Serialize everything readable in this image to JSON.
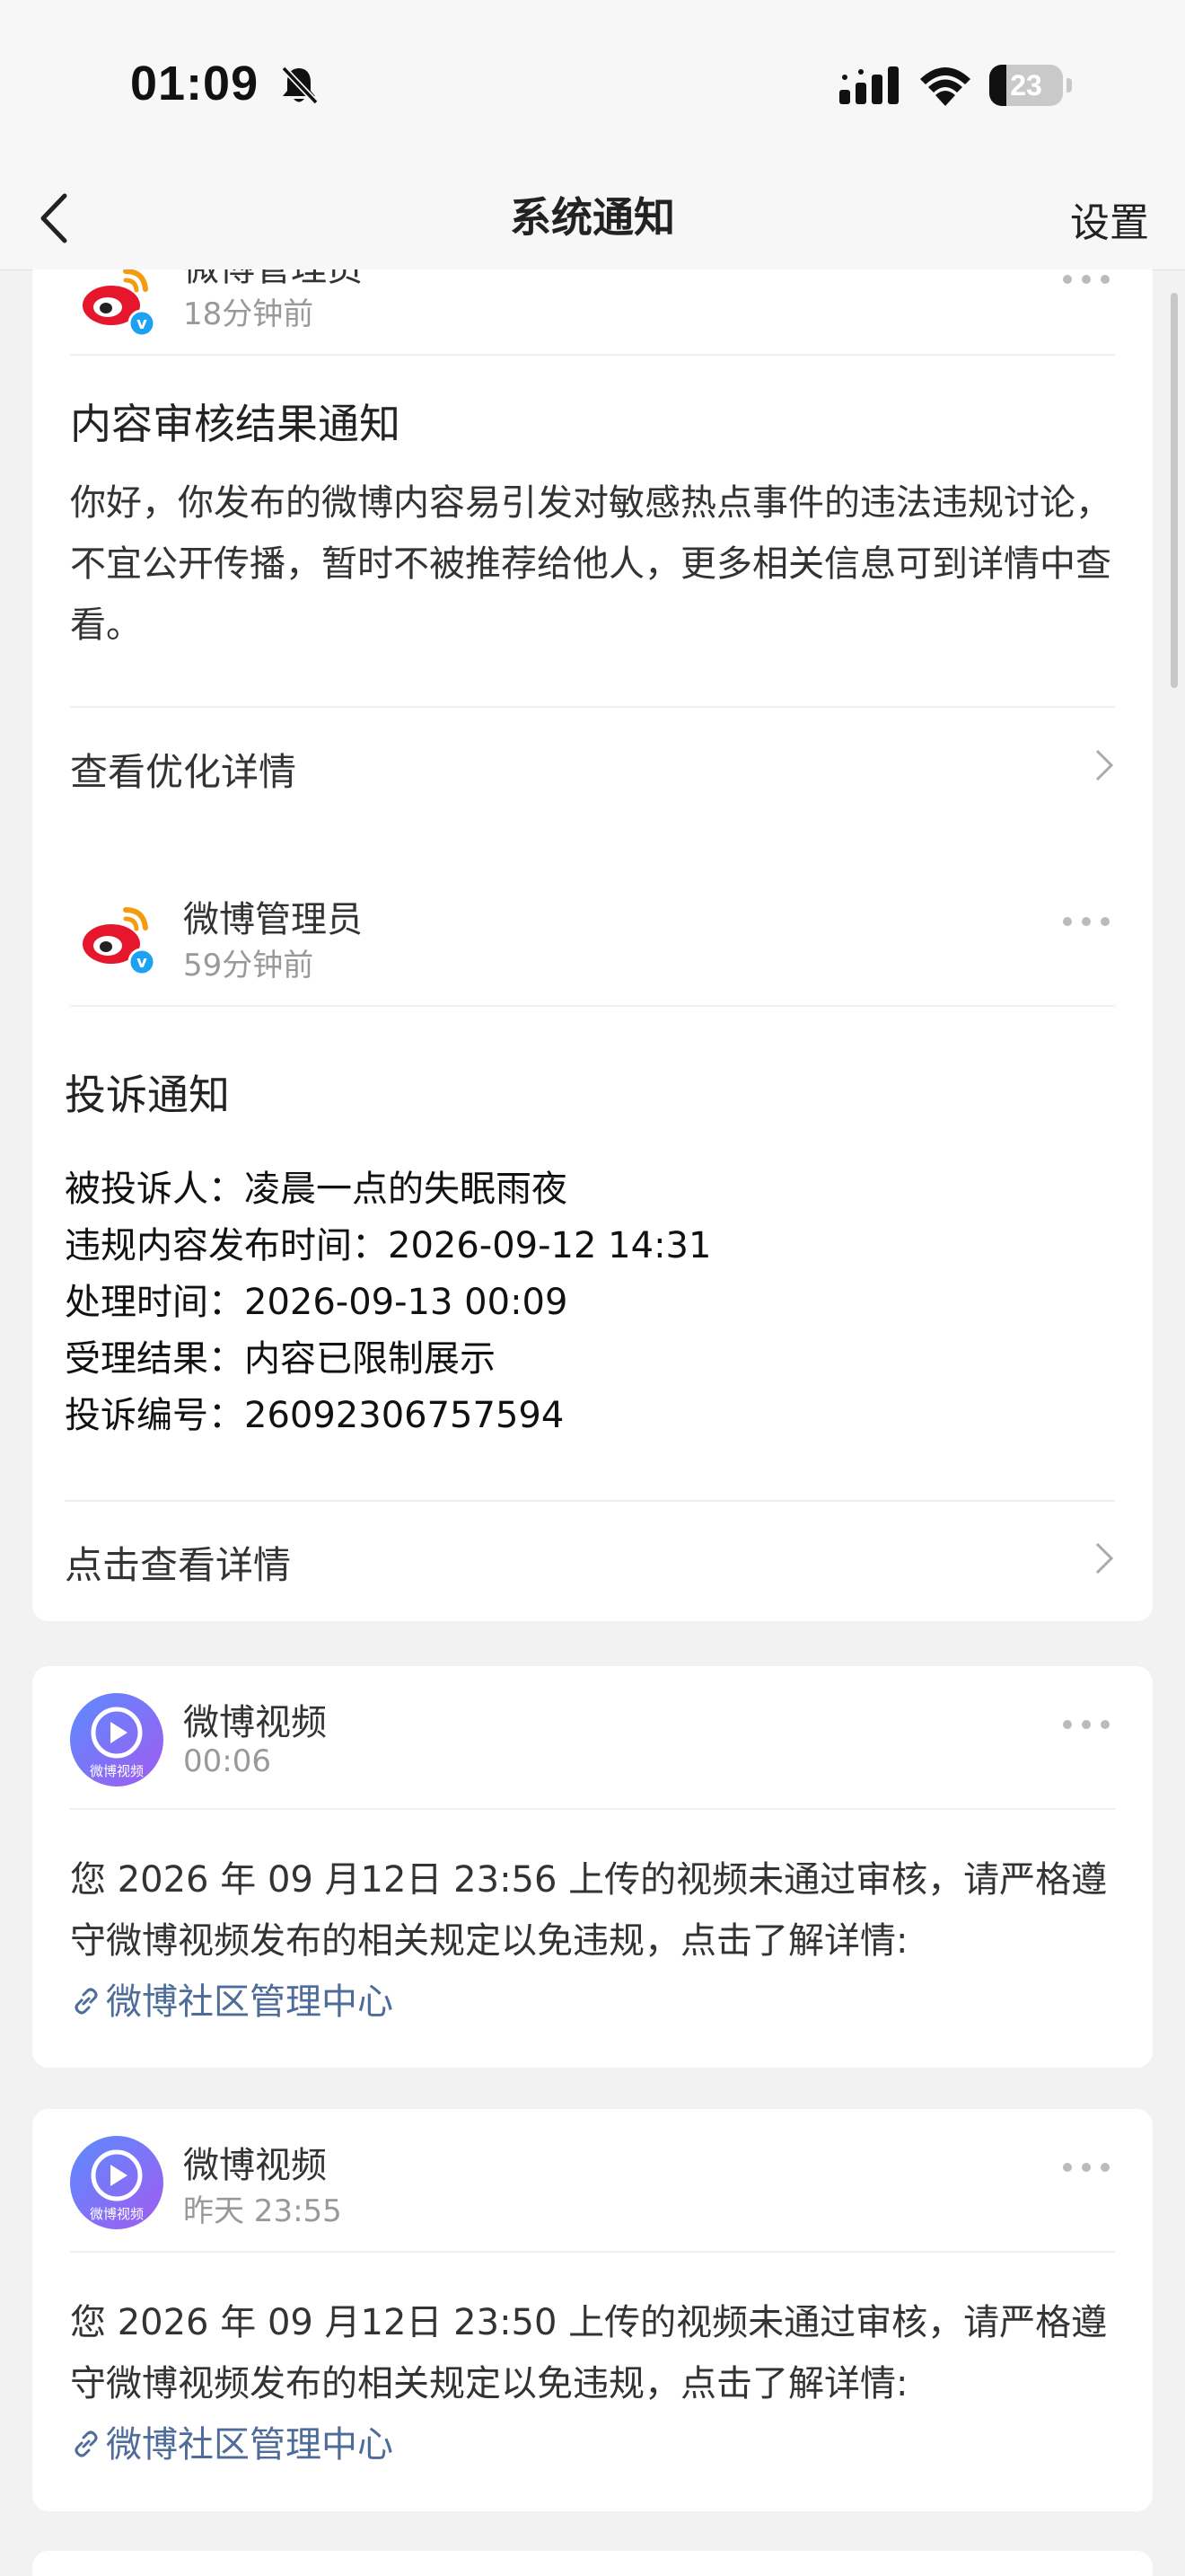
{
  "status": {
    "time": "01:09",
    "battery": "23",
    "battery_level": 0.23
  },
  "nav": {
    "title": "系统通知",
    "settings": "设置"
  },
  "colors": {
    "link": "#4d6c99",
    "weibo_red": "#e6162d",
    "weibo_orange": "#f39c12",
    "verified_blue": "#1da1f2",
    "video_purple": "#7b6cf6"
  },
  "cards": [
    {
      "sender": "微博管理员",
      "time": "18分钟前",
      "title": "内容审核结果通知",
      "body": "你好，你发布的微博内容易引发对敏感热点事件的违法违规讨论，不宜公开传播，暂时不被推荐给他人，更多相关信息可到详情中查看。",
      "action": "查看优化详情"
    },
    {
      "sender": "微博管理员",
      "time": "59分钟前",
      "title": "投诉通知",
      "lines": [
        "被投诉人：凌晨一点的失眠雨夜",
        "违规内容发布时间：2026-09-12 14:31",
        "处理时间：2026-09-13 00:09",
        "受理结果：内容已限制展示",
        "投诉编号：26092306757594"
      ],
      "action": "点击查看详情"
    },
    {
      "sender": "微博视频",
      "time": "00:06",
      "avatar_text": "微博视频",
      "body": "您 2026 年 09 月12日 23:56 上传的视频未通过审核，请严格遵守微博视频发布的相关规定以免违规，点击了解详情:",
      "link": "微博社区管理中心"
    },
    {
      "sender": "微博视频",
      "time": "昨天 23:55",
      "avatar_text": "微博视频",
      "body": "您 2026 年 09 月12日 23:50 上传的视频未通过审核，请严格遵守微博视频发布的相关规定以免违规，点击了解详情:",
      "link": "微博社区管理中心"
    }
  ]
}
